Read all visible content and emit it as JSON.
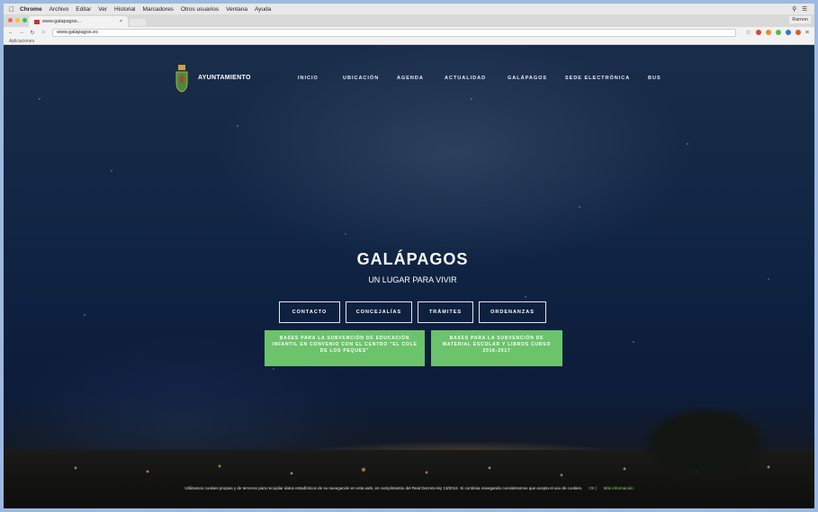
{
  "mac_menu": {
    "app": "Chrome",
    "items": [
      "Archivo",
      "Editar",
      "Ver",
      "Historial",
      "Marcadores",
      "Otros usuarios",
      "Ventana",
      "Ayuda"
    ]
  },
  "browser": {
    "tab_title": "www.galapagos...",
    "profile": "Ramon",
    "url": "www.galapagos.es",
    "bookmarks_label": "Aplicaciones",
    "colors": {
      "close": "#ff5f57",
      "minimize": "#ffbd2e",
      "zoom": "#28c940"
    }
  },
  "site": {
    "brand": "AYUNTAMIENTO",
    "nav": [
      "INICIO",
      "UBICACIÓN",
      "AGENDA",
      "ACTUALIDAD",
      "GALÁPAGOS",
      "SEDE ELECTRÓNICA",
      "BUS"
    ],
    "hero_title": "GALÁPAGOS",
    "hero_subtitle": "UN LUGAR PARA VIVIR",
    "buttons": [
      "CONTACTO",
      "CONCEJALÍAS",
      "TRÁMITES",
      "ORDENANZAS"
    ],
    "green_buttons": [
      "BASES PARA LA SUBVENCIÓN DE EDUCACIÓN INFANTIL EN CONVENIO CON EL CENTRO \"EL COLE DE LOS PEQUES\"",
      "BASES PARA LA SUBVENCIÓN DE MATERIAL ESCOLAR Y LIBROS CURSO 2016-2017"
    ],
    "cookie_text": "Utilizamos cookies propias y de terceros para recopilar datos estadísticos de su navegación en esta web, en cumplimiento del Real Decreto-ley 13/2012. Si continúa navegando consideramos que acepta el uso de cookies.",
    "cookie_ok": "OK",
    "cookie_more": "Más información",
    "accent_green": "#6cc36b"
  }
}
